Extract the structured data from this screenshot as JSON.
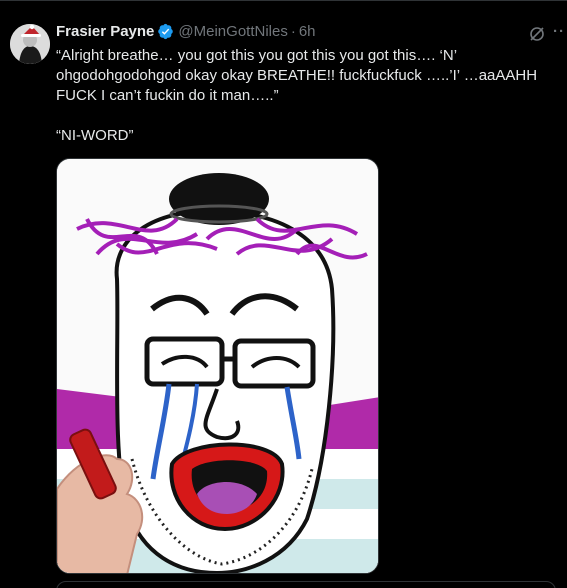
{
  "tweet": {
    "display_name": "Frasier Payne",
    "handle": "@MeinGottNiles",
    "separator": "·",
    "time": "6h",
    "text_line1": "“Alright breathe… you got this you got this you got this…. ‘N’ ohgodohgodohgod okay okay BREATHE!! fuckfuckfuck …..’I’ …aaAAHH FUCK I can’t fuckin do it man…..”",
    "text_line2": "“NI-WORD”",
    "more_label": "··"
  },
  "icons": {
    "verified": "verified-badge-icon",
    "grok": "grok-icon",
    "more": "more-icon"
  },
  "colors": {
    "background": "#000000",
    "text": "#e7e9ea",
    "muted": "#71767b",
    "verified": "#1d9bf0",
    "border": "#2f3336"
  }
}
